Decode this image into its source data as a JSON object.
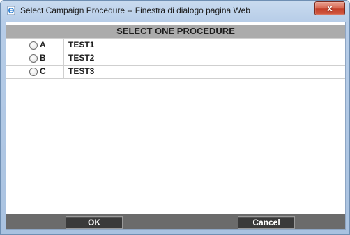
{
  "window": {
    "title": "Select Campaign Procedure -- Finestra di dialogo pagina Web",
    "close_glyph": "x"
  },
  "header": {
    "title": "SELECT ONE PROCEDURE"
  },
  "procedures": [
    {
      "option": "A",
      "name": "TEST1",
      "selected": false
    },
    {
      "option": "B",
      "name": "TEST2",
      "selected": false
    },
    {
      "option": "C",
      "name": "TEST3",
      "selected": false
    }
  ],
  "footer": {
    "ok_label": "OK",
    "cancel_label": "Cancel"
  },
  "colors": {
    "header_bg": "#ababab",
    "footer_bg": "#6b6b6b",
    "button_bg": "#3a3a3a",
    "close_button": "#c3402a"
  },
  "icons": {
    "app": "ie-page-icon",
    "close": "close-icon"
  }
}
